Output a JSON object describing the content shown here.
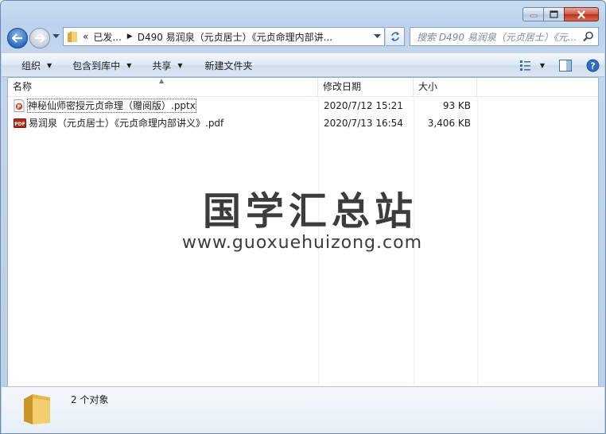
{
  "window": {
    "address": {
      "back_label": "«",
      "crumbs": [
        "已发...",
        "D490 易润泉（元贞居士）《元贞命理内部讲..."
      ]
    },
    "search": {
      "placeholder": "搜索 D490 易润泉（元贞居士）《元..."
    }
  },
  "toolbar": {
    "organize": "组织",
    "include_in_library": "包含到库中",
    "share": "共享",
    "new_folder": "新建文件夹"
  },
  "columns": {
    "name": "名称",
    "modified": "修改日期",
    "size": "大小"
  },
  "files": [
    {
      "name": "神秘仙师密授元贞命理（赠阅版）.pptx",
      "modified": "2020/7/12 15:21",
      "size": "93 KB",
      "type": "pptx"
    },
    {
      "name": "易润泉（元贞居士）《元贞命理内部讲义》.pdf",
      "modified": "2020/7/13 16:54",
      "size": "3,406 KB",
      "type": "pdf"
    }
  ],
  "watermark": {
    "title": "国学汇总站",
    "url": "www.guoxuehuizong.com"
  },
  "details": {
    "count": "2 个对象"
  },
  "icons": {
    "pptx": "powerpoint-file-icon",
    "pdf": "pdf-file-icon",
    "folder": "folder-icon"
  },
  "colors": {
    "accent": "#2e6cc2",
    "frame": "#bcd3ec",
    "close": "#c7432e"
  }
}
